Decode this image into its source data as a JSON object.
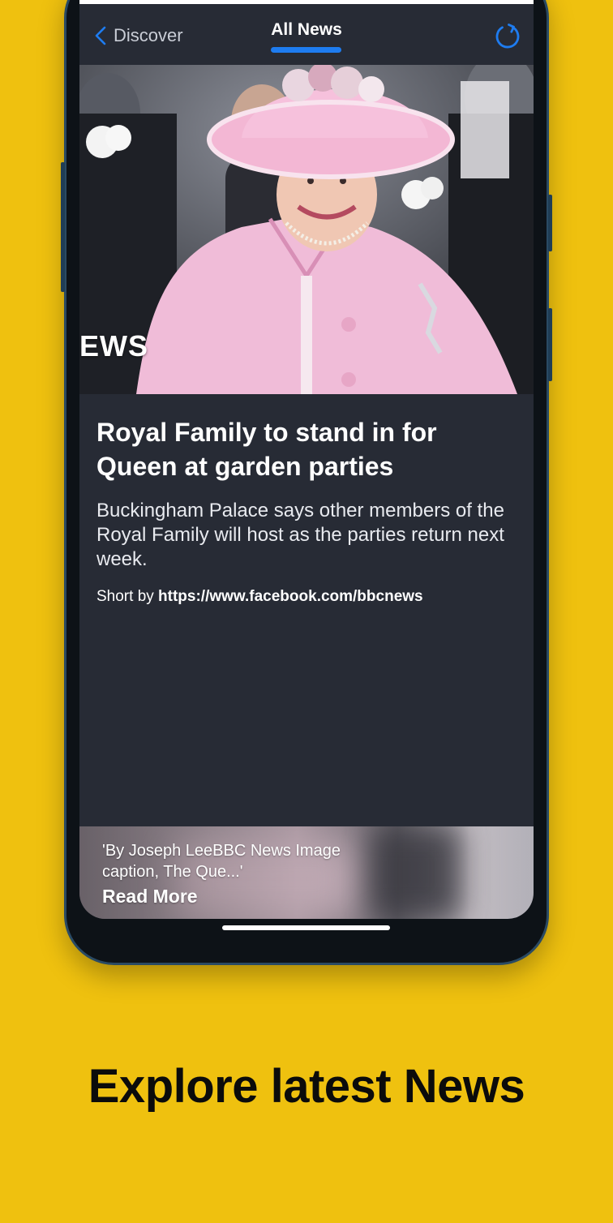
{
  "navbar": {
    "back_label": "Discover",
    "title": "All News",
    "back_icon": "chevron-left-icon",
    "refresh_icon": "refresh-icon",
    "accent_color": "#1E7CF0"
  },
  "article": {
    "image_watermark": "EWS",
    "headline": "Royal Family to stand in for Queen at garden parties",
    "summary": "Buckingham Palace says other members of the Royal Family will host as the parties return next week.",
    "byline_prefix": "Short by",
    "byline_source": "https://www.facebook.com/bbcnews"
  },
  "footer_card": {
    "excerpt": "'By Joseph LeeBBC News Image caption, The Que...'",
    "read_more": "Read More"
  },
  "tagline": "Explore latest News",
  "colors": {
    "background": "#EFC10F",
    "screen_bg": "#272B35",
    "text": "#FFFFFF"
  }
}
